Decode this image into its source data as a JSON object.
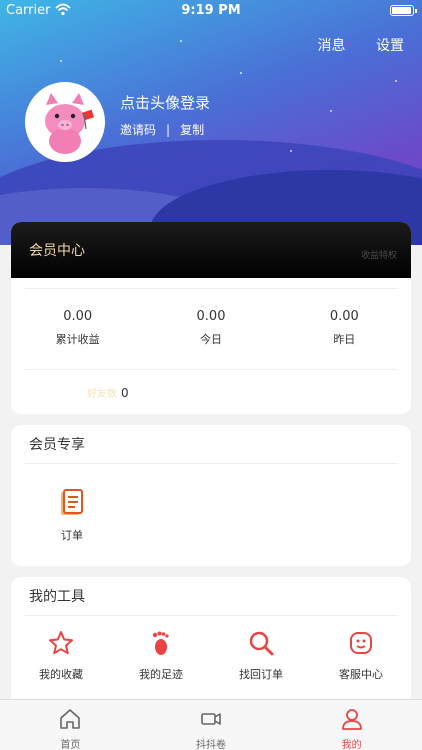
{
  "status": {
    "carrier": "Carrier",
    "time": "9:19 PM"
  },
  "header": {
    "messages": "消息",
    "settings": "设置",
    "login_prompt": "点击头像登录",
    "invite_code": "邀请码",
    "separator": "|",
    "copy": "复制"
  },
  "member_center": {
    "title": "会员中心",
    "ghost_label": "收益特权",
    "stats": [
      {
        "value": "0.00",
        "label": "累计收益"
      },
      {
        "value": "0.00",
        "label": "今日"
      },
      {
        "value": "0.00",
        "label": "昨日"
      }
    ],
    "friends_label": "好友数",
    "friends_count": "0"
  },
  "vip": {
    "title": "会员专享",
    "order_label": "订单"
  },
  "tools": {
    "title": "我的工具",
    "items": [
      {
        "label": "我的收藏",
        "icon": "star-icon"
      },
      {
        "label": "我的足迹",
        "icon": "footprint-icon"
      },
      {
        "label": "找回订单",
        "icon": "search-icon"
      },
      {
        "label": "客服中心",
        "icon": "service-icon"
      }
    ]
  },
  "tabbar": {
    "home": "首页",
    "video": "抖抖卷",
    "mine": "我的"
  },
  "colors": {
    "accent": "#e94545",
    "gold": "#f1d7a6"
  }
}
